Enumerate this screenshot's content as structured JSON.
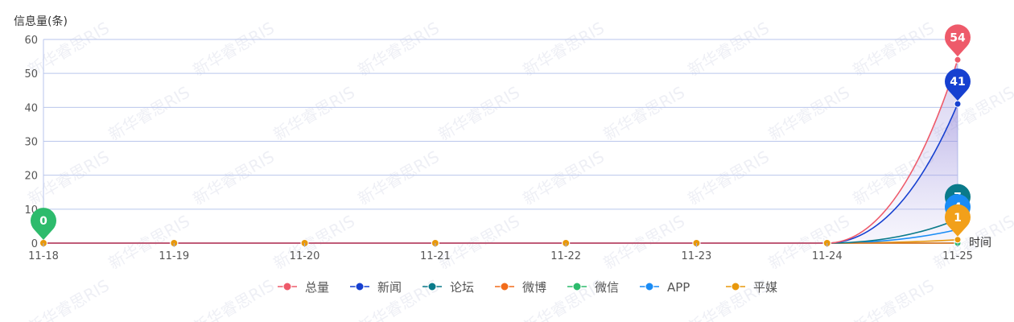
{
  "chart_data": {
    "type": "line",
    "ylabel": "信息量(条)",
    "xlabel": "时间",
    "categories": [
      "11-18",
      "11-19",
      "11-20",
      "11-21",
      "11-22",
      "11-23",
      "11-24",
      "11-25"
    ],
    "ylim": [
      0,
      60
    ],
    "yticks": [
      0,
      10,
      20,
      30,
      40,
      50,
      60
    ],
    "grid": true,
    "legend_position": "bottom",
    "series": [
      {
        "name": "总量",
        "color": "#ee5a6a",
        "values": [
          0,
          0,
          0,
          0,
          0,
          0,
          0,
          54
        ],
        "area": true
      },
      {
        "name": "新闻",
        "color": "#1640d0",
        "values": [
          0,
          0,
          0,
          0,
          0,
          0,
          0,
          41
        ],
        "area": true
      },
      {
        "name": "论坛",
        "color": "#0a7a8a",
        "values": [
          0,
          0,
          0,
          0,
          0,
          0,
          0,
          7
        ]
      },
      {
        "name": "微博",
        "color": "#f26c1a",
        "values": [
          0,
          0,
          0,
          0,
          0,
          0,
          0,
          0
        ]
      },
      {
        "name": "微信",
        "color": "#2dbb6c",
        "values": [
          0,
          0,
          0,
          0,
          0,
          0,
          0,
          0
        ]
      },
      {
        "name": "APP",
        "color": "#1a8cf5",
        "values": [
          0,
          0,
          0,
          0,
          0,
          0,
          0,
          4
        ]
      },
      {
        "name": "平媒",
        "color": "#e8980c",
        "values": [
          0,
          0,
          0,
          0,
          0,
          0,
          0,
          1
        ]
      }
    ],
    "markers": [
      {
        "series": "总量",
        "category": "11-25",
        "value": 54,
        "label": "54",
        "color": "#ee5a6a"
      },
      {
        "series": "新闻",
        "category": "11-25",
        "value": 41,
        "label": "41",
        "color": "#1640d0"
      },
      {
        "series": "论坛",
        "category": "11-25",
        "value": 7,
        "label": "7",
        "color": "#0a7a8a"
      },
      {
        "series": "APP",
        "category": "11-25",
        "value": 4,
        "label": "4",
        "color": "#1a8cf5"
      },
      {
        "series": "平媒",
        "category": "11-25",
        "value": 1,
        "label": "1",
        "color": "#f2a01a"
      },
      {
        "series": "微信",
        "category": "11-18",
        "value": 0,
        "label": "0",
        "color": "#2dbb6c"
      }
    ],
    "watermark": "新华睿思RIS"
  }
}
